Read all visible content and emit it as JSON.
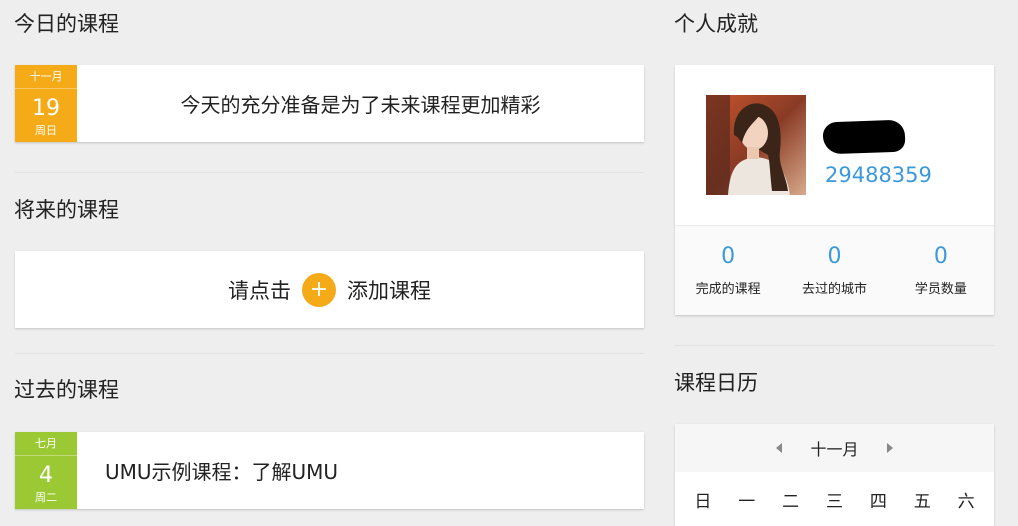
{
  "today": {
    "title": "今日的课程",
    "badge": {
      "month": "十一月",
      "day": "19",
      "weekday": "周日"
    },
    "message": "今天的充分准备是为了未来课程更加精彩"
  },
  "future": {
    "title": "将来的课程",
    "prefix": "请点击",
    "plus_icon": "+",
    "add_label": "添加课程"
  },
  "past": {
    "title": "过去的课程",
    "badge": {
      "month": "七月",
      "day": "4",
      "weekday": "周二"
    },
    "course": "UMU示例课程：了解UMU"
  },
  "achievements": {
    "title": "个人成就",
    "user_id": "29488359",
    "stats": [
      {
        "value": "0",
        "label": "完成的课程"
      },
      {
        "value": "0",
        "label": "去过的城市"
      },
      {
        "value": "0",
        "label": "学员数量"
      }
    ]
  },
  "calendar": {
    "title": "课程日历",
    "month": "十一月",
    "weekdays": [
      "日",
      "一",
      "二",
      "三",
      "四",
      "五",
      "六"
    ]
  },
  "colors": {
    "accent_orange": "#f5ab17",
    "accent_green": "#9bc933",
    "link_blue": "#3a9ad9",
    "background": "#eeeeee"
  }
}
